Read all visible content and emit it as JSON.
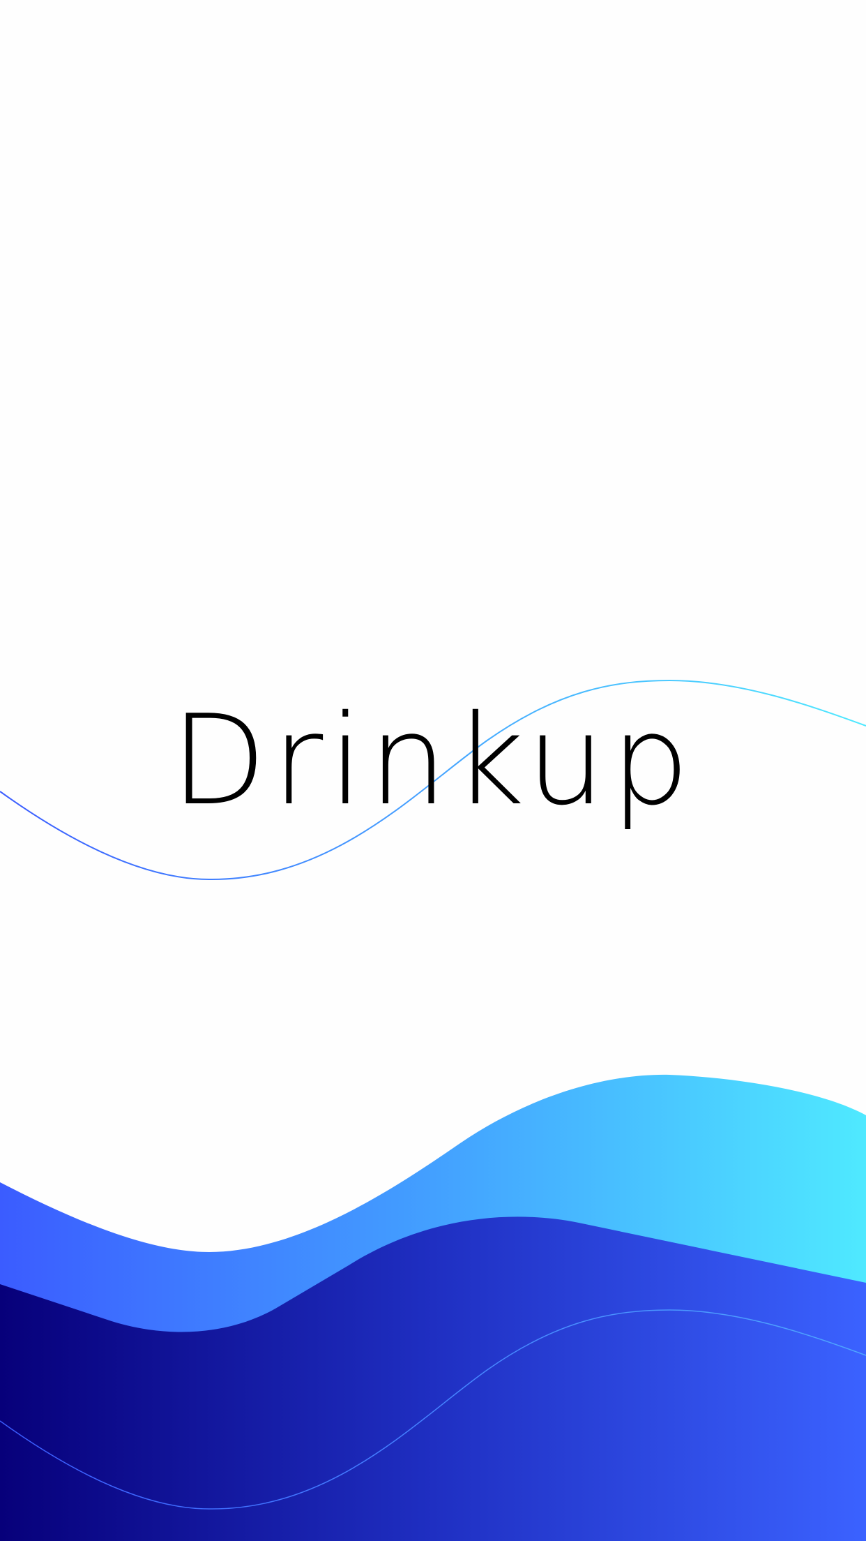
{
  "app": {
    "title": "Drinkup"
  },
  "colors": {
    "background": "#fefefe",
    "title_text": "#000000",
    "wave_light_start": "#3b5cff",
    "wave_light_mid": "#43a0ff",
    "wave_light_end": "#4fe9ff",
    "wave_dark_start": "#07007a",
    "wave_dark_mid": "#1f2fc2",
    "wave_dark_end": "#3b62ff",
    "line_start": "#3b5cff",
    "line_end": "#4fe9ff"
  },
  "icons": {
    "decor_top_wave": "thin-wave-line",
    "decor_bottom_waves": "gradient-wave-shapes"
  }
}
